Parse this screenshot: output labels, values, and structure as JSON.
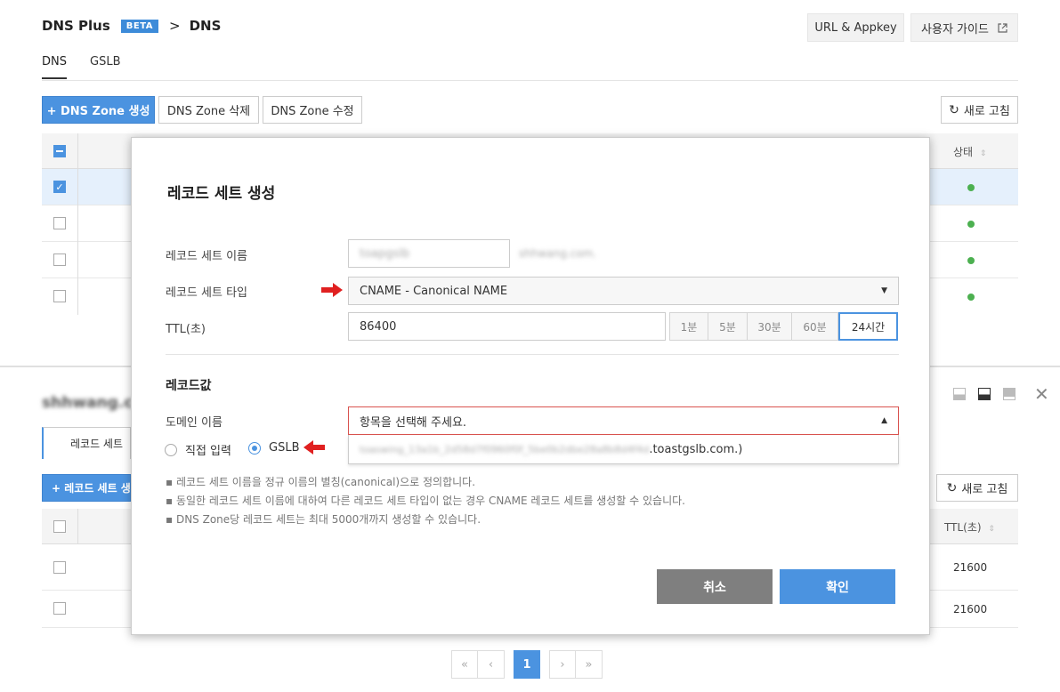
{
  "header": {
    "product": "DNS Plus",
    "beta": "BETA",
    "chevron": ">",
    "section": "DNS",
    "url_appkey": "URL & Appkey",
    "user_guide": "사용자 가이드"
  },
  "tabs": [
    {
      "label": "DNS"
    },
    {
      "label": "GSLB"
    }
  ],
  "toolbar": {
    "create": "+  DNS Zone 생성",
    "delete": "DNS Zone 삭제",
    "edit": "DNS Zone 수정",
    "refresh": "새로 고침"
  },
  "zone_table": {
    "status_header": "상태"
  },
  "lower_panel": {
    "tab_label": "레코드 세트",
    "create_button": "+  레코드 세트 생",
    "refresh": "새로 고침",
    "ttl_header": "TTL(초)",
    "rows": [
      {
        "ttl": "21600"
      },
      {
        "ttl": "21600"
      }
    ]
  },
  "pager": {
    "current": "1",
    "first": "«",
    "prev": "‹",
    "next": "›",
    "last": "»"
  },
  "modal": {
    "title": "레코드 세트 생성",
    "name_label": "레코드 세트 이름",
    "name_value": "toapgslb",
    "name_suffix": "shhwang.com.",
    "type_label": "레코드 세트 타입",
    "type_value": "CNAME - Canonical NAME",
    "ttl_label": "TTL(초)",
    "ttl_value": "86400",
    "ttl_presets": [
      "1분",
      "5분",
      "30분",
      "60분",
      "24시간"
    ],
    "record_value_heading": "레코드값",
    "domain_label": "도메인 이름",
    "domain_placeholder": "항목을 선택해 주세요.",
    "dropdown_option_blurred": "toaswing_13a1b_2d58d7f0960f0f_5be0b2dbe28a8b8d4f4d",
    "dropdown_option_suffix": ".toastgslb.com.)",
    "radio_direct": "직접 입력",
    "radio_gslb": "GSLB",
    "hints": [
      "레코드 세트 이름을 정규 이름의 별칭(canonical)으로 정의합니다.",
      "동일한 레코드 세트 이름에 대하여 다른 레코드 세트 타입이 없는 경우 CNAME 레코드 세트를 생성할 수 있습니다.",
      "DNS Zone당 레코드 세트는 최대 5000개까지 생성할 수 있습니다."
    ],
    "cancel": "취소",
    "confirm": "확인"
  },
  "colors": {
    "primary": "#4b93e0",
    "cancel": "#7f7f7f",
    "status_ok": "#4cb050",
    "arrow": "#e02020"
  }
}
